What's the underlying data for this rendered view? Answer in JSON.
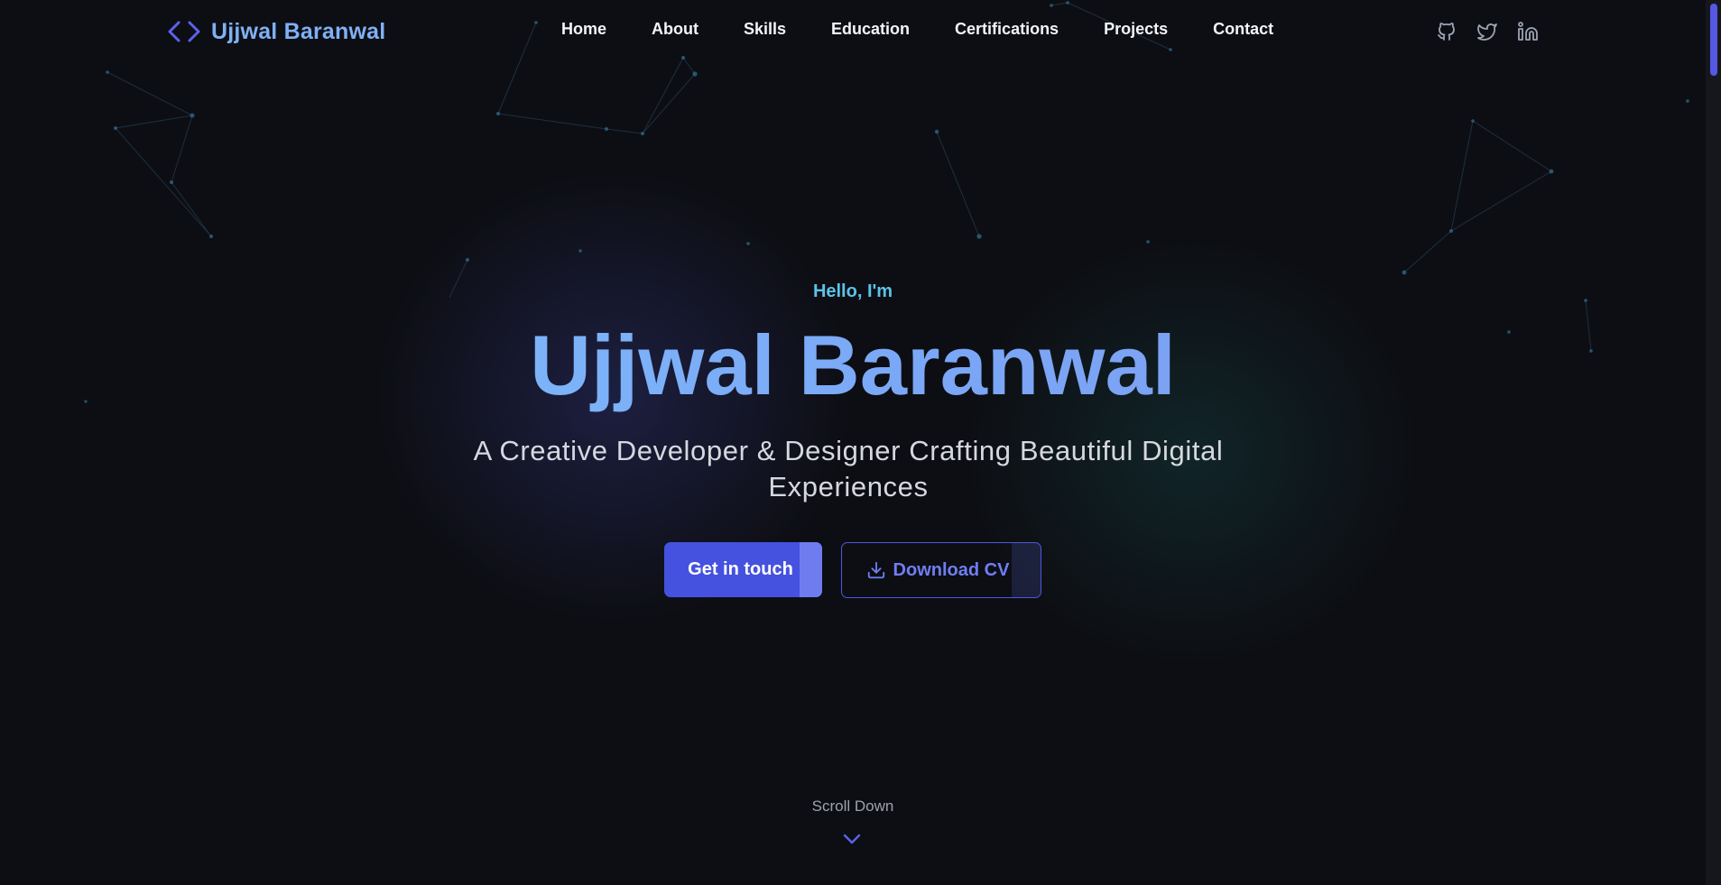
{
  "brand": {
    "name": "Ujjwal Baranwal",
    "icon": "code-brackets-icon"
  },
  "nav": {
    "items": [
      {
        "label": "Home"
      },
      {
        "label": "About"
      },
      {
        "label": "Skills"
      },
      {
        "label": "Education"
      },
      {
        "label": "Certifications"
      },
      {
        "label": "Projects"
      },
      {
        "label": "Contact"
      }
    ]
  },
  "socials": [
    {
      "icon": "github-icon"
    },
    {
      "icon": "twitter-icon"
    },
    {
      "icon": "linkedin-icon"
    }
  ],
  "hero": {
    "greeting": "Hello, I'm",
    "name": "Ujjwal Baranwal",
    "tagline": "A Creative Developer & Designer Crafting Beautiful Digital Experiences",
    "primary_button": "Get in touch",
    "secondary_button": "Download CV",
    "secondary_icon": "download-icon"
  },
  "scroll": {
    "label": "Scroll Down",
    "icon": "chevron-down-icon"
  },
  "colors": {
    "background": "#0d0e13",
    "accent": "#4552df",
    "brand_text": "#7fb0f5",
    "greeting": "#5cc2e8"
  }
}
